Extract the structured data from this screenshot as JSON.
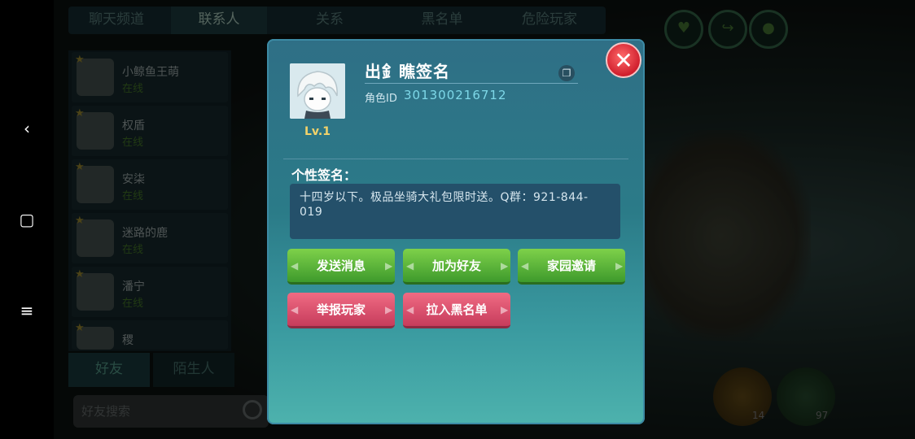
{
  "system_nav": {
    "back_icon": "‹",
    "home_icon": "▢",
    "menu_icon": "≡"
  },
  "background": {
    "tabs": [
      "聊天频道",
      "联系人",
      "关系",
      "黑名单",
      "危险玩家"
    ],
    "contacts": [
      {
        "name": "小鲸鱼王萌",
        "status": "在线"
      },
      {
        "name": "权盾",
        "status": "在线"
      },
      {
        "name": "安柒",
        "status": "在线"
      },
      {
        "name": "迷路的鹿",
        "status": "在线"
      },
      {
        "name": "潘宁",
        "status": "在线"
      },
      {
        "name": "稷",
        "status": ""
      }
    ],
    "bottom_tabs": [
      "好友",
      "陌生人"
    ],
    "search_placeholder": "好友搜索",
    "counts": [
      "14",
      "97"
    ]
  },
  "profile": {
    "name": "出釒瞧签名",
    "level": "Lv.1",
    "role_id_label": "角色ID",
    "role_id": "301300216712",
    "signature_title": "个性签名：",
    "signature": "十四岁以下。极品坐骑大礼包限时送。Q群：921-844-019"
  },
  "buttons": {
    "send_message": "发送消息",
    "add_friend": "加为好友",
    "home_invite": "家园邀请",
    "report_player": "举报玩家",
    "blacklist": "拉入黑名单"
  },
  "colors": {
    "green_button": "#5cb83a",
    "red_button": "#e2516f",
    "dialog_bg": "#2f7a89",
    "id_text": "#7ed8e8"
  }
}
